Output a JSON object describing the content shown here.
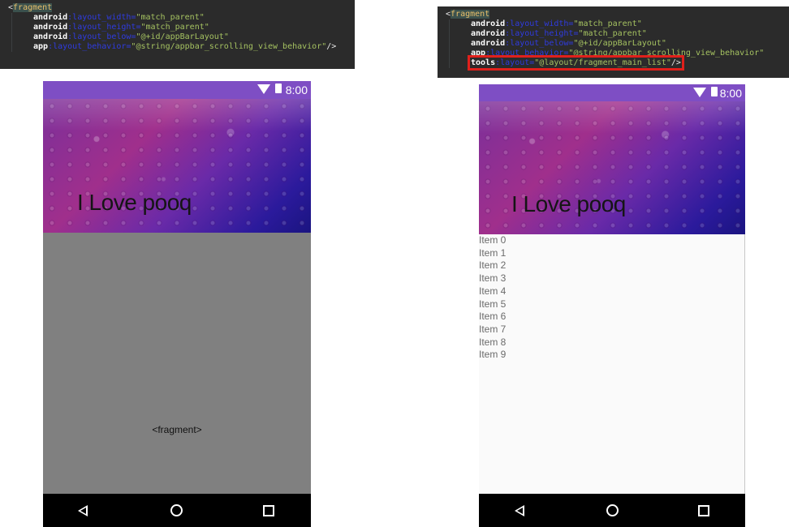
{
  "left_code": {
    "open_tag": "<",
    "tag": "fragment",
    "lines": [
      {
        "ns": "android",
        "attr": ":layout_width=",
        "value": "\"match_parent\"",
        "end": ""
      },
      {
        "ns": "android",
        "attr": ":layout_height=",
        "value": "\"match_parent\"",
        "end": ""
      },
      {
        "ns": "android",
        "attr": ":layout_below=",
        "value": "\"@+id/appBarLayout\"",
        "end": ""
      },
      {
        "ns": "app",
        "attr": ":layout_behavior=",
        "value": "\"@string/appbar_scrolling_view_behavior\"",
        "end": "/>"
      }
    ]
  },
  "right_code": {
    "open_tag": "<",
    "tag": "fragment",
    "lines": [
      {
        "ns": "android",
        "attr": ":layout_width=",
        "value": "\"match_parent\"",
        "end": ""
      },
      {
        "ns": "android",
        "attr": ":layout_height=",
        "value": "\"match_parent\"",
        "end": ""
      },
      {
        "ns": "android",
        "attr": ":layout_below=",
        "value": "\"@+id/appBarLayout\"",
        "end": ""
      },
      {
        "ns": "app",
        "attr": ":layout_behavior=",
        "value": "\"@string/appbar_scrolling_view_behavior\"",
        "end": ""
      },
      {
        "ns": "tools",
        "attr": ":layout=",
        "value": "\"@layout/fragment_main_list\"",
        "end": "/>"
      }
    ],
    "highlight_color": "#e0201b"
  },
  "left_phone": {
    "status_time": "8:00",
    "banner_title": "I Love pooq",
    "fragment_label": "<fragment>",
    "nav": [
      "back-icon",
      "home-icon",
      "recents-icon"
    ]
  },
  "right_phone": {
    "status_time": "8:00",
    "banner_title": "I Love pooq",
    "list_items": [
      "Item 0",
      "Item 1",
      "Item 2",
      "Item 3",
      "Item 4",
      "Item 5",
      "Item 6",
      "Item 7",
      "Item 8",
      "Item 9"
    ],
    "nav": [
      "back-icon",
      "home-icon",
      "recents-icon"
    ]
  },
  "colors": {
    "status_bar": "#7e4ec4",
    "preview_gray": "#808080",
    "nav_bar": "#000000",
    "editor_bg": "#2b2b2b"
  }
}
